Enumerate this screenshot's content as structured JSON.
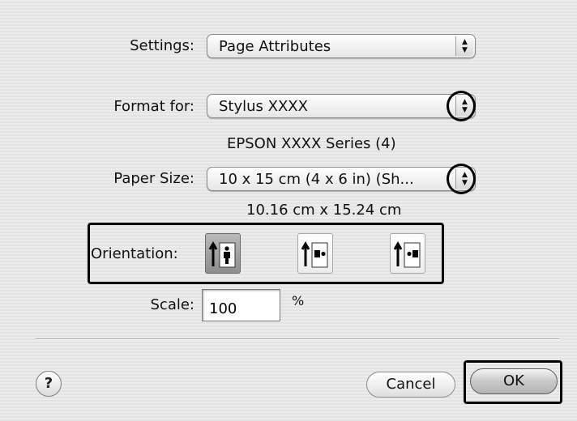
{
  "settings": {
    "label": "Settings:",
    "value": "Page Attributes"
  },
  "format_for": {
    "label": "Format for:",
    "value": "Stylus XXXX",
    "description": "EPSON XXXX Series (4)"
  },
  "paper_size": {
    "label": "Paper Size:",
    "value": "10 x 15 cm (4 x 6 in) (Sh...",
    "dimensions": "10.16 cm x 15.24 cm"
  },
  "orientation": {
    "label": "Orientation:",
    "options": [
      {
        "name": "portrait",
        "selected": true
      },
      {
        "name": "landscape-left",
        "selected": false
      },
      {
        "name": "landscape-right",
        "selected": false
      }
    ]
  },
  "scale": {
    "label": "Scale:",
    "value": "100",
    "unit": "%"
  },
  "buttons": {
    "cancel": "Cancel",
    "ok": "OK",
    "help": "?"
  },
  "colors": {
    "window_bg": "#ececec",
    "selected_orientation": "#9a9a9a",
    "highlight_outline": "#000000"
  }
}
